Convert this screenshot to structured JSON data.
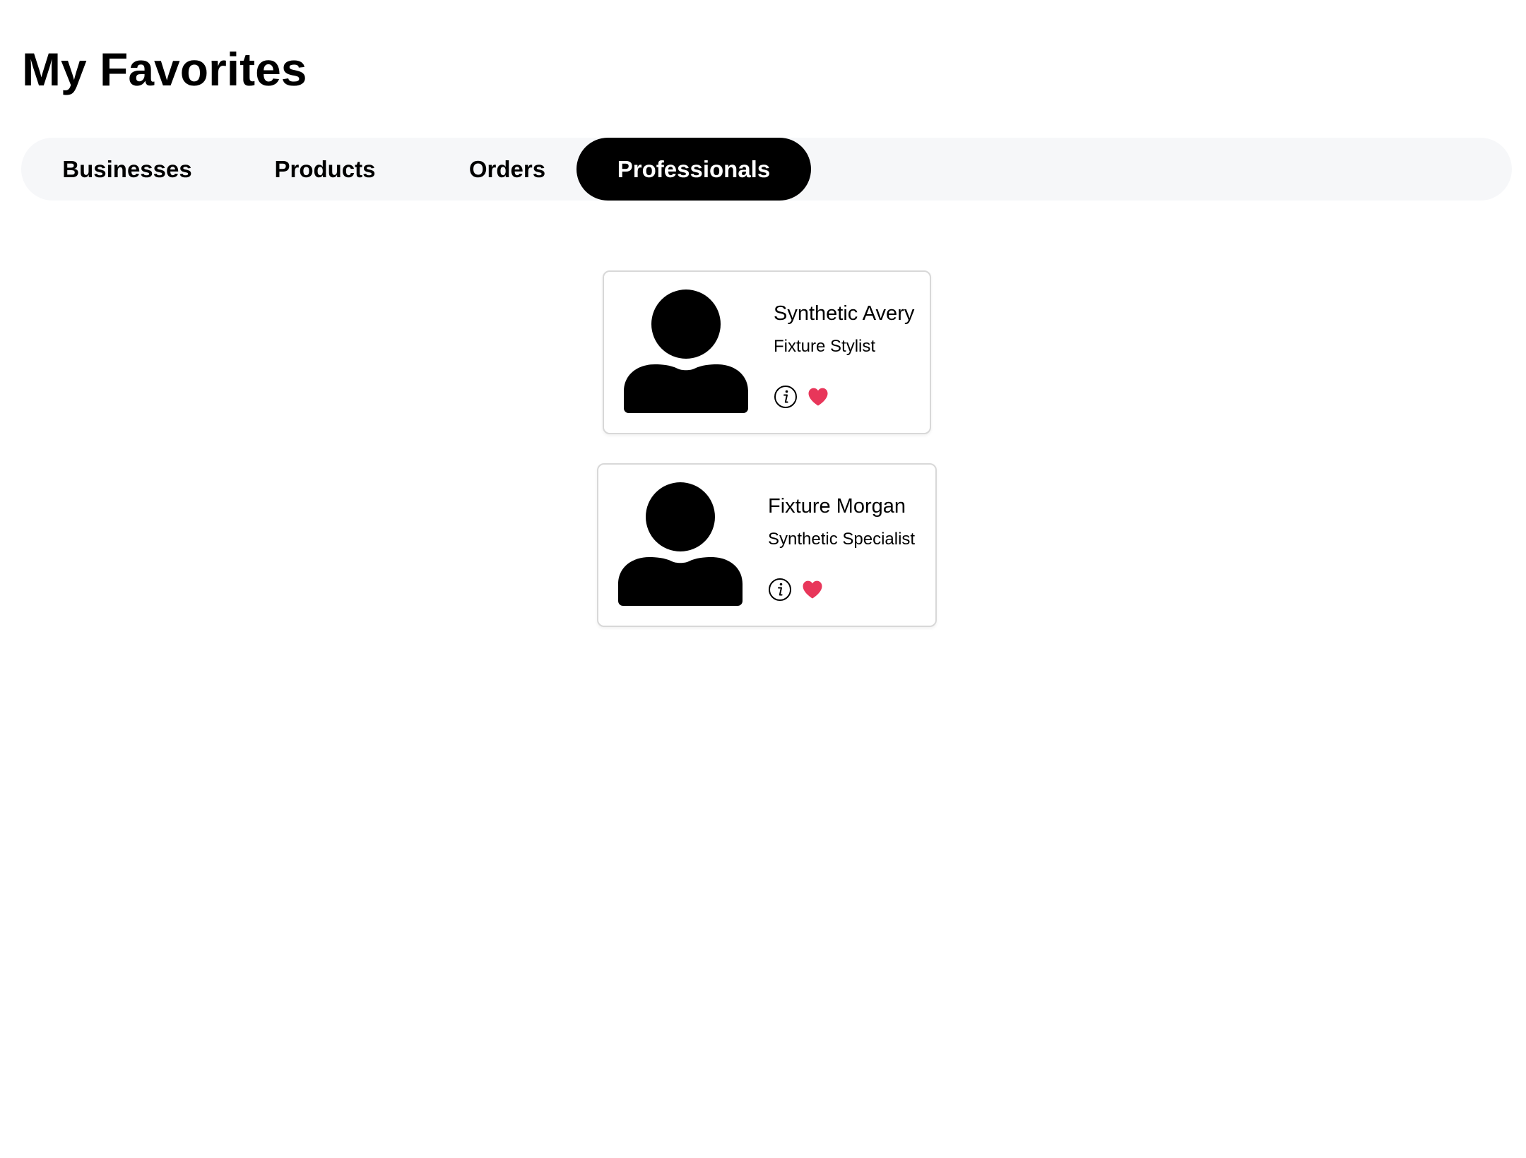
{
  "page": {
    "title": "My Favorites"
  },
  "tabs": [
    {
      "label": "Businesses",
      "active": false
    },
    {
      "label": "Products",
      "active": false
    },
    {
      "label": "Orders",
      "active": false
    },
    {
      "label": "Professionals",
      "active": true
    }
  ],
  "professionals": [
    {
      "name": "Synthetic Avery",
      "role": "Fixture Stylist",
      "avatar_icon": "user-silhouette-icon",
      "favorited": true
    },
    {
      "name": "Fixture Morgan",
      "role": "Synthetic Specialist",
      "avatar_icon": "user-silhouette-icon",
      "favorited": true
    }
  ],
  "colors": {
    "active_tab_bg": "#000000",
    "active_tab_text": "#ffffff",
    "tab_bar_bg": "#f6f7f9",
    "heart": "#e8365a"
  }
}
